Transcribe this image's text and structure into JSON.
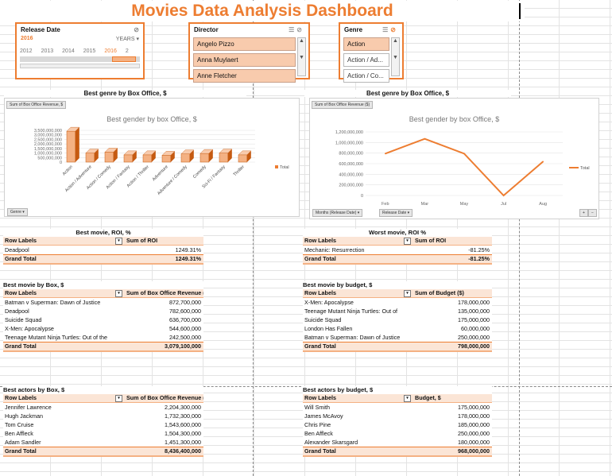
{
  "dashboard": {
    "title": "Movies Data Analysis Dashboard"
  },
  "timeline_slicer": {
    "title": "Release Date",
    "selected_year": "2016",
    "period_label": "YEARS",
    "years": [
      "2012",
      "2013",
      "2014",
      "2015",
      "2016",
      "2"
    ]
  },
  "director_slicer": {
    "title": "Director",
    "items": [
      {
        "label": "Angelo Pizzo",
        "selected": true
      },
      {
        "label": "Anna Muylaert",
        "selected": true
      },
      {
        "label": "Anne Fletcher",
        "selected": true
      }
    ]
  },
  "genre_slicer": {
    "title": "Genre",
    "items": [
      {
        "label": "Action",
        "selected": true
      },
      {
        "label": "Action / Ad...",
        "selected": false
      },
      {
        "label": "Action / Co...",
        "selected": false
      }
    ]
  },
  "bar_chart": {
    "caption": "Best genre by Box Office, $",
    "field_button": "Sum of Box Office Revenue, $",
    "axis_button": "Genre",
    "legend_label": "Total"
  },
  "line_chart": {
    "caption": "Best genre by Box Office, $",
    "field_button": "Sum of Box Office Revenue ($)",
    "axis_buttons": [
      "Months (Release Date)",
      "Release Date"
    ],
    "legend_label": "Total",
    "zoom_buttons": [
      "+",
      "−"
    ]
  },
  "chart_data": [
    {
      "type": "bar",
      "title": "Best gender by box Office, $",
      "categories": [
        "Action",
        "Action / Adventure",
        "Action / Comedy",
        "Action / Fantasy",
        "Action / Thriller",
        "Adventure",
        "Adventure / Comedy",
        "Comedy",
        "Sci-Fi / Fantasy",
        "Thriller"
      ],
      "series": [
        {
          "name": "Total",
          "values": [
            3400000000,
            1000000000,
            1100000000,
            800000000,
            800000000,
            750000000,
            900000000,
            950000000,
            1000000000,
            800000000
          ]
        }
      ],
      "yticks": [
        "3,500,000,000",
        "3,000,000,000",
        "2,500,000,000",
        "2,000,000,000",
        "1,500,000,000",
        "1,000,000,000",
        "500,000,000",
        "0"
      ],
      "ylim": [
        0,
        3500000000
      ]
    },
    {
      "type": "line",
      "title": "Best gender by box Office, $",
      "categories": [
        "Feb",
        "Mar",
        "May",
        "Jul",
        "Aug"
      ],
      "series": [
        {
          "name": "Total",
          "values": [
            790000000,
            1070000000,
            790000000,
            0,
            640000000
          ]
        }
      ],
      "yticks": [
        "1,200,000,000",
        "1,000,000,000",
        "800,000,000",
        "600,000,000",
        "400,000,000",
        "200,000,000",
        "0"
      ],
      "ylim": [
        0,
        1200000000
      ]
    }
  ],
  "pivots": [
    {
      "caption": "Best movie, ROI, %",
      "col1": "Row Labels",
      "col2": "Sum of ROI",
      "rows": [
        {
          "label": "Deadpool",
          "value": "1249.31%"
        }
      ],
      "total_label": "Grand Total",
      "total_value": "1249.31%"
    },
    {
      "caption": "Worst movie, ROI %",
      "col1": "Row Labels",
      "col2": "Sum of ROI",
      "rows": [
        {
          "label": "Mechanic: Resurrection",
          "value": "-81.25%"
        }
      ],
      "total_label": "Grand Total",
      "total_value": "-81.25%"
    },
    {
      "caption": "Best movie by Box, $",
      "col1": "Row Labels",
      "col2": "Sum of Box Office Revenue ($)",
      "rows": [
        {
          "label": "Batman v Superman: Dawn of Justice",
          "value": "872,700,000"
        },
        {
          "label": "Deadpool",
          "value": "782,600,000"
        },
        {
          "label": "Suicide Squad",
          "value": "636,700,000"
        },
        {
          "label": "X-Men: Apocalypse",
          "value": "544,600,000"
        },
        {
          "label": "Teenage Mutant Ninja Turtles: Out of the",
          "value": "242,500,000"
        }
      ],
      "total_label": "Grand Total",
      "total_value": "3,079,100,000"
    },
    {
      "caption": "Best movie by budget, $",
      "col1": "Row Labels",
      "col2": "Sum of Budget ($)",
      "rows": [
        {
          "label": "X-Men: Apocalypse",
          "value": "178,000,000"
        },
        {
          "label": "Teenage Mutant Ninja Turtles: Out of",
          "value": "135,000,000"
        },
        {
          "label": "Suicide Squad",
          "value": "175,000,000"
        },
        {
          "label": "London Has Fallen",
          "value": "60,000,000"
        },
        {
          "label": "Batman v Superman: Dawn of Justice",
          "value": "250,000,000"
        }
      ],
      "total_label": "Grand Total",
      "total_value": "798,000,000"
    },
    {
      "caption": "Best actors by Box, $",
      "col1": "Row Labels",
      "col2": "Sum of Box Office Revenue ($)",
      "rows": [
        {
          "label": "Jennifer Lawrence",
          "value": "2,204,300,000"
        },
        {
          "label": "Hugh Jackman",
          "value": "1,732,300,000"
        },
        {
          "label": "Tom Cruise",
          "value": "1,543,600,000"
        },
        {
          "label": "Ben Affleck",
          "value": "1,504,300,000"
        },
        {
          "label": "Adam Sandler",
          "value": "1,451,300,000"
        }
      ],
      "total_label": "Grand Total",
      "total_value": "8,436,400,000"
    },
    {
      "caption": "Best actors by budget, $",
      "col1": "Row Labels",
      "col2": "Budget, $",
      "rows": [
        {
          "label": "Will Smith",
          "value": "175,000,000"
        },
        {
          "label": "James McAvoy",
          "value": "178,000,000"
        },
        {
          "label": "Chris Pine",
          "value": "185,000,000"
        },
        {
          "label": "Ben Affleck",
          "value": "250,000,000"
        },
        {
          "label": "Alexander Skarsgard",
          "value": "180,000,000"
        }
      ],
      "total_label": "Grand Total",
      "total_value": "968,000,000"
    }
  ],
  "colors": {
    "accent": "#ed7d31",
    "light": "#fbe5d6",
    "slicer_item": "#f8cbad"
  }
}
